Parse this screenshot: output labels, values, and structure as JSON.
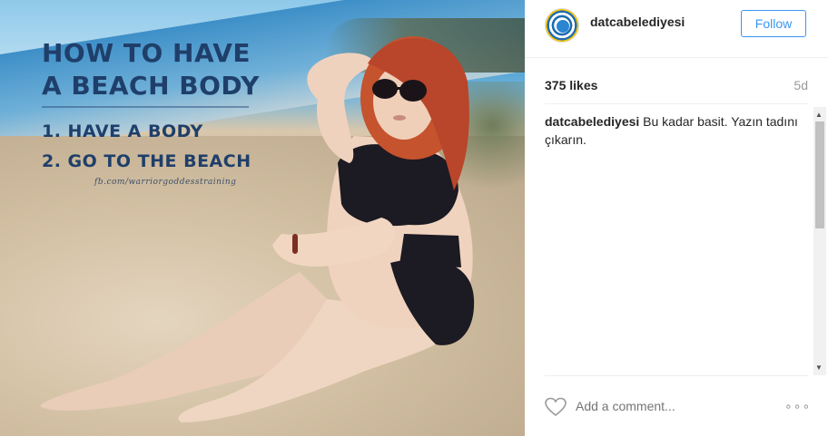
{
  "post": {
    "poster": {
      "line1": "HOW TO HAVE",
      "line2": "A BEACH BODY",
      "item1": "1. HAVE A BODY",
      "item2": "2. GO TO THE BEACH",
      "credit": "fb.com/warriorgoddesstraining"
    }
  },
  "header": {
    "username": "datcabelediyesi",
    "follow_label": "Follow"
  },
  "stats": {
    "likes": "375 likes",
    "time": "5d"
  },
  "caption": {
    "username": "datcabelediyesi",
    "text": "Bu kadar basit. Yazın tadını çıkarın."
  },
  "comments": {
    "placeholder": "Add a comment...",
    "more_label": "∘∘∘"
  },
  "icons": {
    "avatar": "municipality-seal",
    "like": "heart-icon",
    "more": "ellipsis-icon"
  },
  "colors": {
    "accent": "#3897f0",
    "muted": "#999999"
  }
}
